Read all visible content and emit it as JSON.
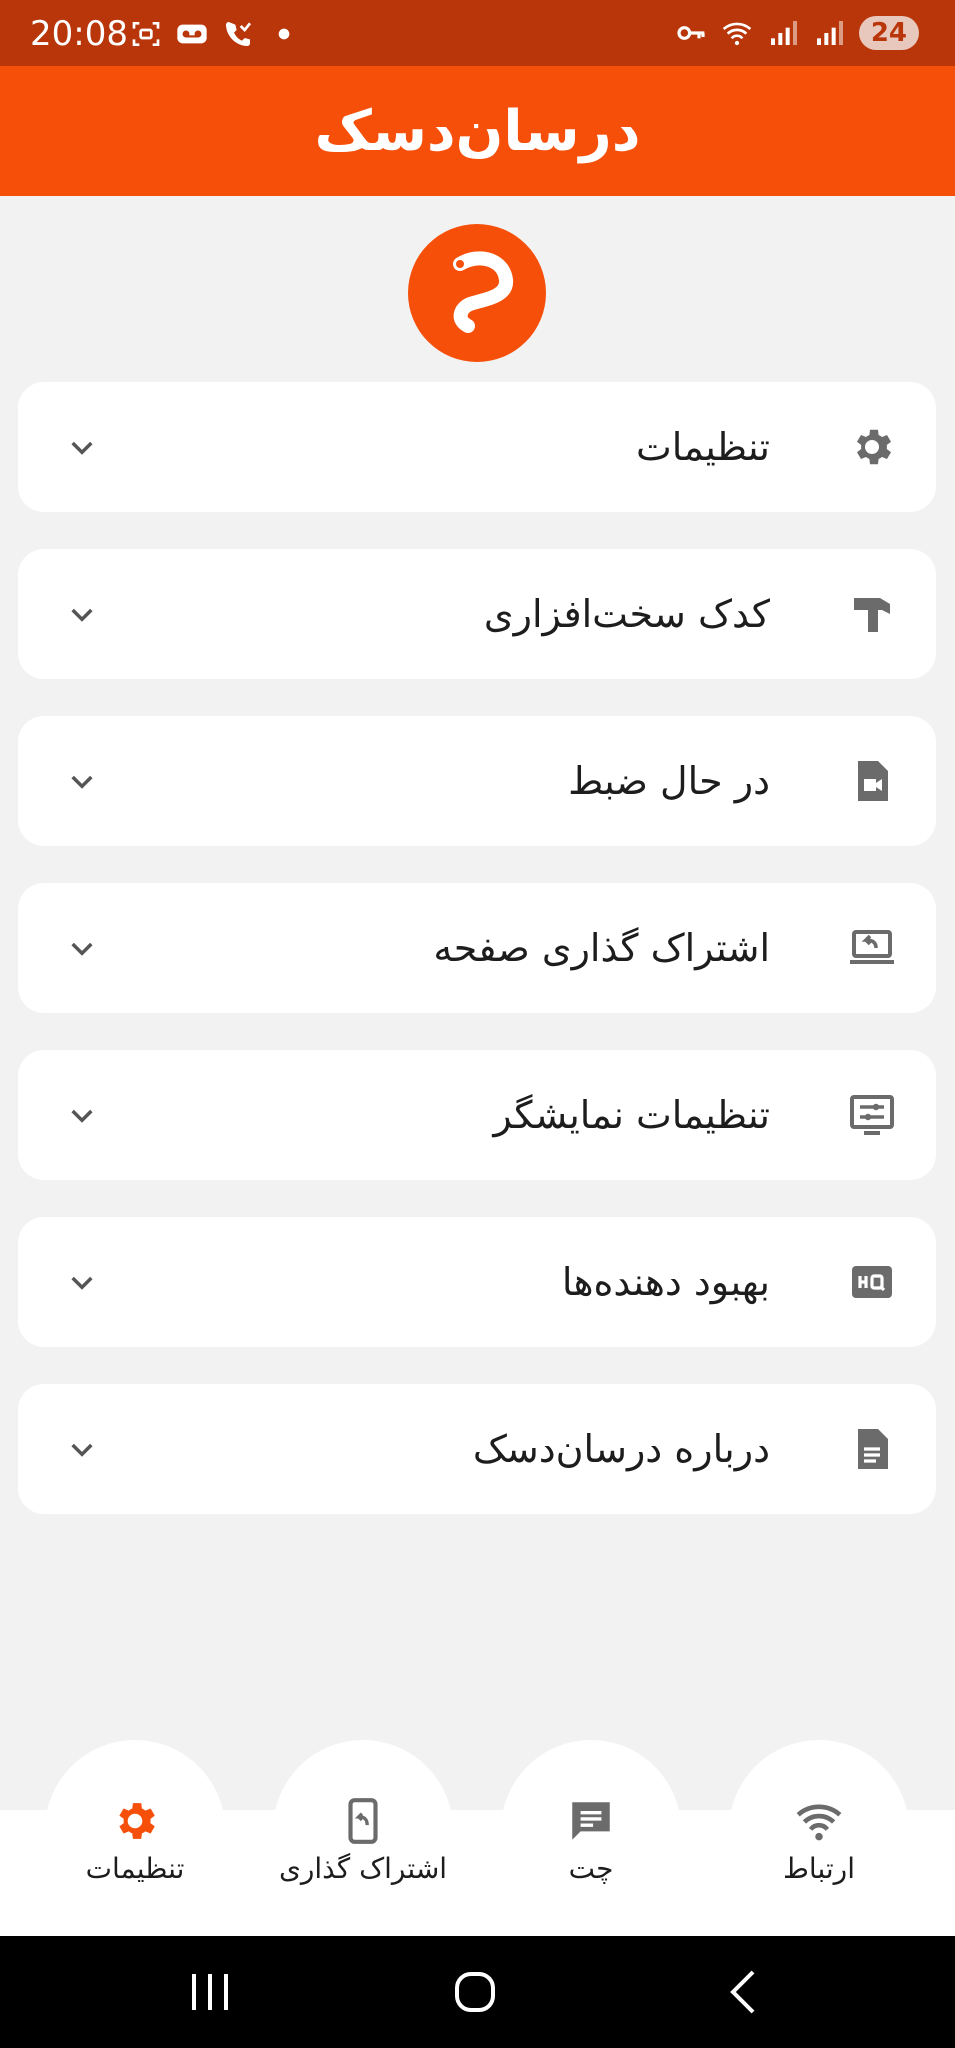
{
  "status_bar": {
    "time": "20:08",
    "battery": "24",
    "left_icons": [
      "screenshot-icon",
      "voicemail-icon",
      "wifi-calling-icon",
      "dot-icon"
    ],
    "right_icons": [
      "vpn-key-icon",
      "wifi-icon",
      "signal-icon",
      "signal-icon"
    ]
  },
  "app_bar": {
    "title": "درسان‌دسک"
  },
  "colors": {
    "accent": "#f64f0a",
    "status_bar": "#b9360a",
    "icon_gray": "#6b6b6b"
  },
  "menu": {
    "items": [
      {
        "label": "تنظیمات",
        "icon": "gear-icon"
      },
      {
        "label": "کدک سخت‌افزاری",
        "icon": "hammer-icon"
      },
      {
        "label": "در حال ضبط",
        "icon": "video-file-icon"
      },
      {
        "label": "اشتراک گذاری صفحه",
        "icon": "screen-share-icon"
      },
      {
        "label": "تنظیمات نمایشگر",
        "icon": "display-settings-icon"
      },
      {
        "label": "بهبود دهنده‌ها",
        "icon": "hq-icon"
      },
      {
        "label": "درباره درسان‌دسک",
        "icon": "document-icon"
      }
    ]
  },
  "bottom_nav": {
    "items": [
      {
        "label": "تنظیمات",
        "icon": "gear-icon",
        "active": true
      },
      {
        "label": "اشتراک گذاری",
        "icon": "phone-share-icon",
        "active": false
      },
      {
        "label": "چت",
        "icon": "chat-icon",
        "active": false
      },
      {
        "label": "ارتباط",
        "icon": "wifi-icon",
        "active": false
      }
    ]
  }
}
